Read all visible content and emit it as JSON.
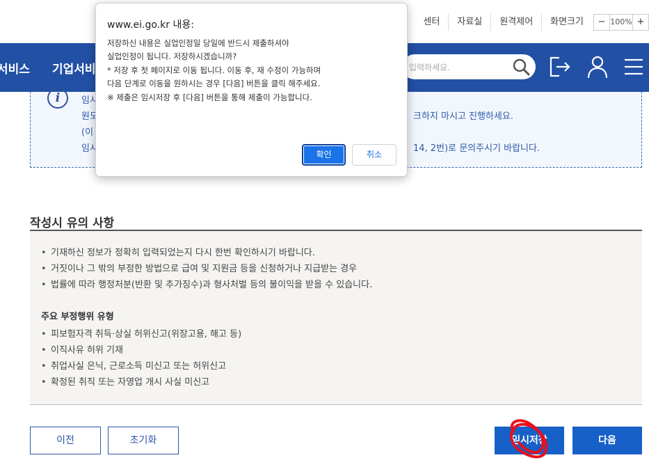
{
  "header": {
    "util_links": [
      "센터",
      "자료실",
      "원격제어",
      "화면크기"
    ],
    "zoom": {
      "minus": "−",
      "value": "100%",
      "plus": "+"
    }
  },
  "nav": {
    "menu_1": "서비스",
    "menu_2": "기업서비",
    "search_placeholder": "입력하세요."
  },
  "info_box": {
    "lines": [
      "임시",
      "원도",
      "(이",
      "임시"
    ],
    "right_1": "크하지 마시고 진행하세요.",
    "right_2": "14, 2번)로 문의주시기 바랍니다."
  },
  "cautions": {
    "title": "작성시 유의 사항",
    "items": [
      "기재하신 정보가 정확히 입력되었는지 다시 한번 확인하시기 바랍니다.",
      "거짓이나 그 밖의 부정한 방법으로 급여 및 지원금 등을 신청하거나 지급받는 경우",
      "법률에 따라 행정처분(반환 및 추가징수)과 형사처벌 등의 불이익을 받을 수 있습니다."
    ],
    "subtitle": "주요 부정행위 유형",
    "fraud_types": [
      "피보험자격 취득·상실 허위신고(위장고용, 해고 등)",
      "이직사유 허위 기재",
      "취업사실 은닉, 근로소득 미신고 또는 허위신고",
      "확정된 취직 또는 자영업 개시 사실 미신고"
    ]
  },
  "buttons": {
    "prev": "이전",
    "reset": "초기화",
    "temp_save": "임시저장",
    "next": "다음"
  },
  "dialog": {
    "title": "www.ei.go.kr 내용:",
    "lines": [
      "저장하신 내용은 실업인정일 당일에 반드시 제출하셔야",
      "실업인정이 됩니다. 저장하시겠습니까?",
      " * 저장 후 첫 페이지로 이동 됩니다. 이동 후, 재 수정이 가능하며",
      "   다음 단계로 이동을 원하시는 경우 [다음] 버튼을 클릭 해주세요.",
      " ※ 제출은 임시저장 후 [다음] 버튼을 통해 제출이 가능합니다."
    ],
    "ok": "확인",
    "cancel": "취소"
  },
  "colors": {
    "nav_blue": "#2250a5",
    "button_blue": "#1760c8",
    "dialog_ok": "#1a73e8",
    "scribble_red": "#e8101a"
  }
}
